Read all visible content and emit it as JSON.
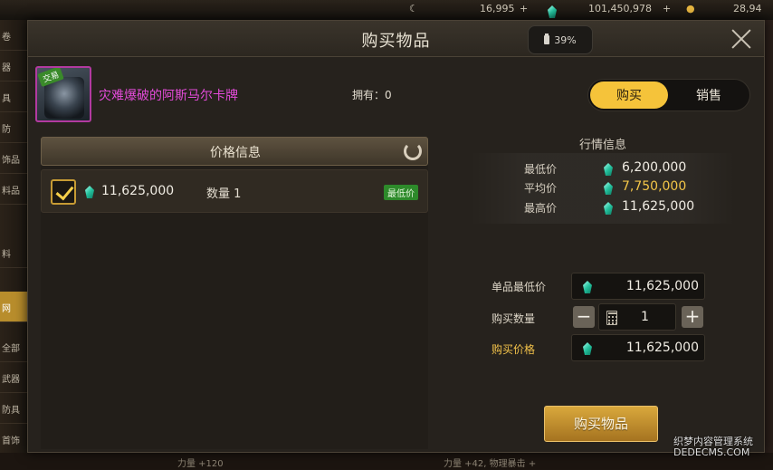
{
  "topbar": {
    "currency1": "16,995",
    "currency2": "101,450,978",
    "currency3": "28,94"
  },
  "sidebar": {
    "tabs": [
      "卷",
      "器",
      "具",
      "防",
      "饰品",
      "料品",
      "料",
      "网",
      "全部",
      "武器",
      "防具",
      "首饰"
    ]
  },
  "bottom_bar": {
    "text1": "力量 +120",
    "text2": "力量 +42, 物理暴击 +"
  },
  "dialog": {
    "title": "购买物品",
    "battery": "39%"
  },
  "item": {
    "badge": "交易",
    "name": "灾难爆破的阿斯马尔卡牌",
    "owned": "拥有：0"
  },
  "mode_toggle": {
    "buy": "购买",
    "sell": "销售"
  },
  "price_info": {
    "title": "价格信息",
    "offers": [
      {
        "price": "11,625,000",
        "qty_label": "数量 1",
        "badge": "最低价"
      }
    ]
  },
  "market_info": {
    "title": "行情信息",
    "rows": [
      {
        "label": "最低价",
        "value": "6,200,000"
      },
      {
        "label": "平均价",
        "value": "7,750,000"
      },
      {
        "label": "最高价",
        "value": "11,625,000"
      }
    ]
  },
  "purchase_form": {
    "unit_min_label": "单品最低价",
    "unit_min_value": "11,625,000",
    "qty_label": "购买数量",
    "qty_value": "1",
    "total_label": "购买价格",
    "total_value": "11,625,000",
    "buy_button": "购买物品"
  },
  "watermark": {
    "line1": "织梦内容管理系统",
    "line2": "DEDECMS.COM"
  },
  "colors": {
    "accent_gold": "#f5c33a",
    "item_name": "#e24bd8",
    "average_price": "#f3c648",
    "lowest_badge": "#2d8a2a"
  }
}
